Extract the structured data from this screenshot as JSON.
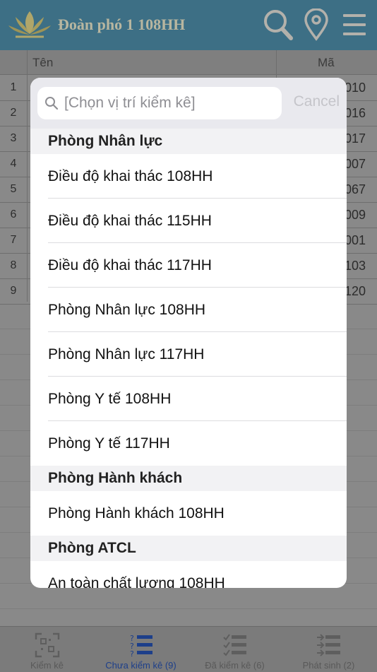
{
  "header": {
    "title": "Đoàn phó 1 108HH"
  },
  "table": {
    "columns": [
      "Tên",
      "Mã"
    ],
    "rows": [
      {
        "num": "1",
        "code": "010"
      },
      {
        "num": "2",
        "code": "016"
      },
      {
        "num": "3",
        "code": "017"
      },
      {
        "num": "4",
        "code": "007"
      },
      {
        "num": "5",
        "code": "067"
      },
      {
        "num": "6",
        "code": "009"
      },
      {
        "num": "7",
        "code": "001"
      },
      {
        "num": "8",
        "code": "103"
      },
      {
        "num": "9",
        "code": "120"
      }
    ]
  },
  "picker": {
    "search_placeholder": "[Chọn vị trí kiểm kê]",
    "cancel_label": "Cancel",
    "sections": [
      {
        "title": "Phòng Nhân lực",
        "items": [
          "Điều độ khai thác 108HH",
          "Điều độ khai thác 115HH",
          "Điều độ khai thác 117HH",
          "Phòng Nhân lực 108HH",
          "Phòng Nhân lực 117HH",
          "Phòng Y tế 108HH",
          "Phòng Y tế 117HH"
        ]
      },
      {
        "title": "Phòng Hành khách",
        "items": [
          "Phòng Hành khách 108HH"
        ]
      },
      {
        "title": "Phòng ATCL",
        "items": [
          "An toàn chất lượng 108HH"
        ]
      }
    ]
  },
  "tabs": [
    {
      "label": "Kiểm kê",
      "icon": "qr-scan-icon",
      "active": false
    },
    {
      "label": "Chưa kiểm kê (9)",
      "icon": "list-icon",
      "active": true
    },
    {
      "label": "Đã kiểm kê (6)",
      "icon": "checklist-icon",
      "active": false
    },
    {
      "label": "Phát sinh (2)",
      "icon": "add-list-icon",
      "active": false
    }
  ],
  "colors": {
    "header": "#3d6f85",
    "active_tab": "#1d3f8a"
  }
}
